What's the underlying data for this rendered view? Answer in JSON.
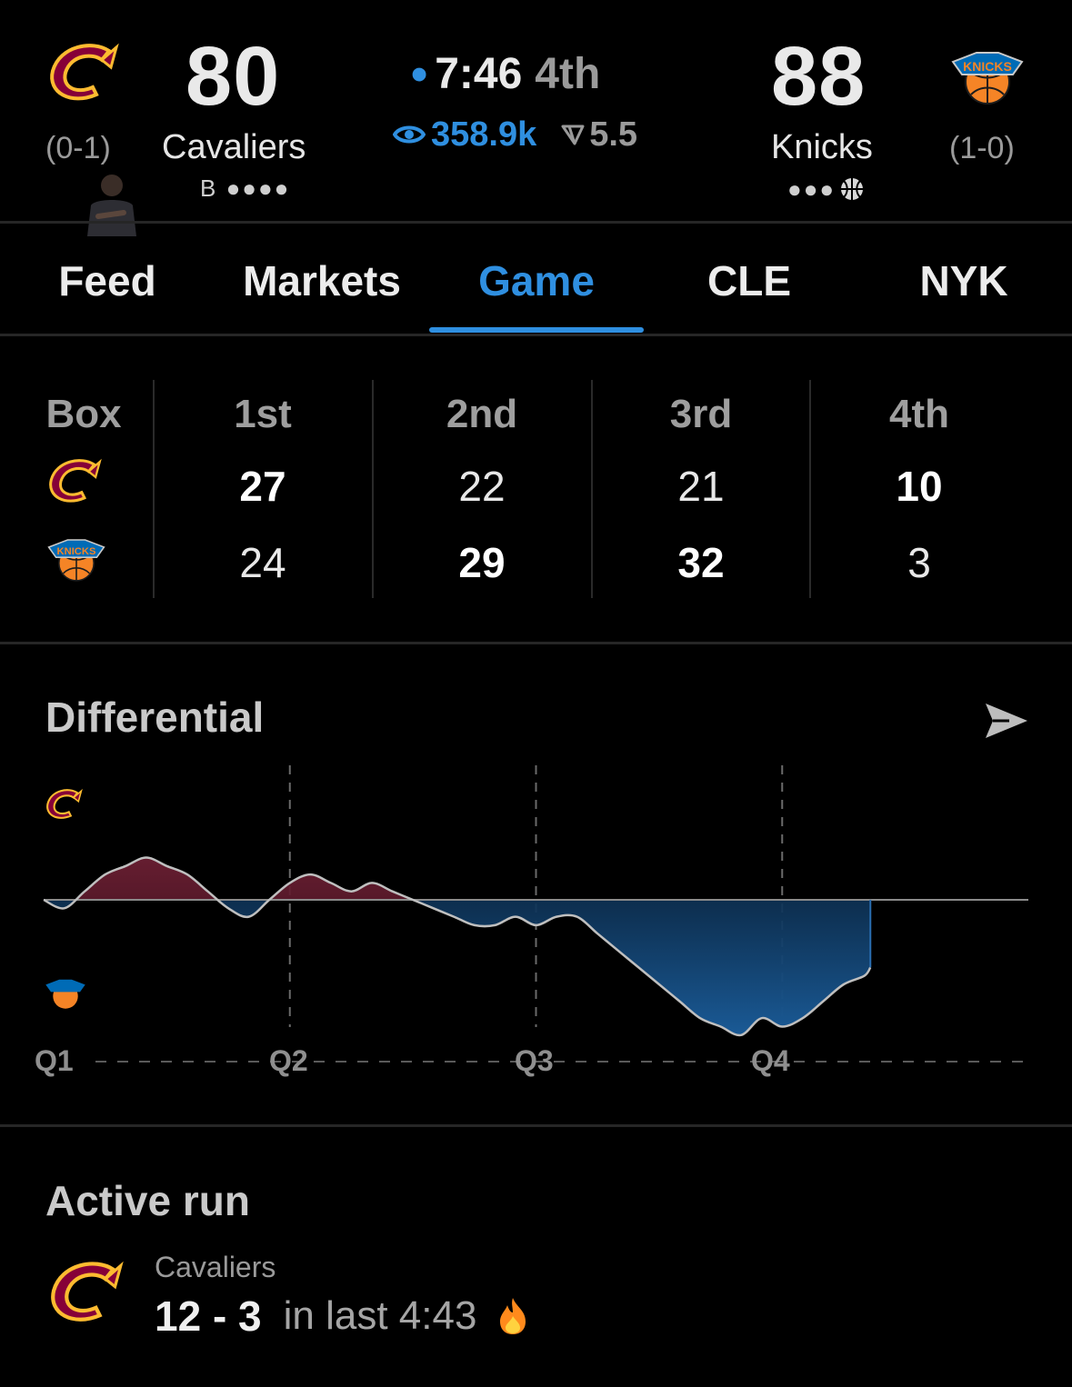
{
  "header": {
    "home": {
      "score": "80",
      "name": "Cavaliers",
      "record": "(0-1)",
      "indicator": "B ●●●●",
      "logo_icon": "cavaliers-logo"
    },
    "away": {
      "score": "88",
      "name": "Knicks",
      "record": "(1-0)",
      "indicator": "●●●",
      "logo_icon": "knicks-logo"
    },
    "clock": "7:46",
    "period": "4th",
    "live_dot": "•",
    "viewers": "358.9k",
    "spread": "5.5",
    "colors": {
      "accent": "#2f8fe0",
      "cavs_wine": "#860038",
      "cavs_gold": "#FDBB30",
      "knicks_blue": "#006BB6",
      "knicks_orange": "#F58426"
    }
  },
  "tabs": [
    {
      "label": "Feed",
      "active": false
    },
    {
      "label": "Markets",
      "active": false
    },
    {
      "label": "Game",
      "active": true
    },
    {
      "label": "CLE",
      "active": false
    },
    {
      "label": "NYK",
      "active": false
    }
  ],
  "box_score": {
    "header": "Box",
    "periods": [
      "1st",
      "2nd",
      "3rd",
      "4th"
    ],
    "home": [
      "27",
      "22",
      "21",
      "10"
    ],
    "away": [
      "24",
      "29",
      "32",
      "3"
    ]
  },
  "differential": {
    "title": "Differential",
    "quarters": [
      "Q1",
      "Q2",
      "Q3",
      "Q4"
    ],
    "share_icon": "send-icon"
  },
  "chart_data": {
    "type": "area",
    "title": "Differential",
    "x_labels": [
      "Q1",
      "Q2",
      "Q3",
      "Q4"
    ],
    "xlim": [
      0,
      48
    ],
    "ylim": [
      -16,
      16
    ],
    "baseline": 0,
    "grid": "vertical dashed at quarter breaks",
    "series": [
      {
        "positive_color": "#5a1a2a",
        "negative_color": "#0d3b66",
        "x": [
          0,
          1,
          2,
          3,
          4,
          5,
          6,
          7,
          8,
          9,
          10,
          11,
          12,
          13,
          14,
          15,
          16,
          17,
          18,
          19,
          20,
          21,
          22,
          23,
          24,
          25,
          26,
          27,
          28,
          29,
          30,
          31,
          32,
          33,
          34,
          35,
          36,
          37,
          38,
          39,
          40,
          40.3
        ],
        "y": [
          0,
          -1,
          1,
          3,
          4,
          5,
          4,
          3,
          1,
          -1,
          -2,
          0,
          2,
          3,
          2,
          1,
          2,
          1,
          0,
          -1,
          -2,
          -3,
          -3,
          -2,
          -3,
          -2,
          -2,
          -4,
          -6,
          -8,
          -10,
          -12,
          -14,
          -15,
          -16,
          -14,
          -15,
          -14,
          -12,
          -10,
          -9,
          -8
        ]
      }
    ]
  },
  "active_run": {
    "title": "Active run",
    "team": "Cavaliers",
    "score": "12 - 3",
    "window": "in last 4:43",
    "fire_icon": "fire-icon"
  }
}
